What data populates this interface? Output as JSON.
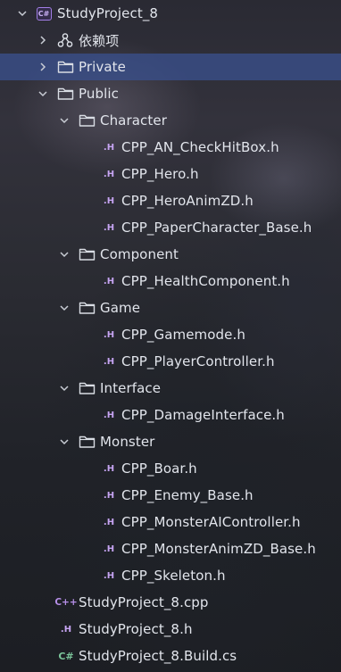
{
  "tree": {
    "root": {
      "label": "StudyProject_8",
      "icon": "project-icon",
      "expanded": true
    },
    "dependencies": {
      "label": "依赖项",
      "icon": "dependencies-icon",
      "expanded": false
    },
    "private_folder": {
      "label": "Private",
      "icon": "folder-icon",
      "expanded": false,
      "selected": true
    },
    "public_folder": {
      "label": "Public",
      "icon": "folder-icon",
      "expanded": true,
      "folders": [
        {
          "label": "Character",
          "files": [
            "CPP_AN_CheckHitBox.h",
            "CPP_Hero.h",
            "CPP_HeroAnimZD.h",
            "CPP_PaperCharacter_Base.h"
          ]
        },
        {
          "label": "Component",
          "files": [
            "CPP_HealthComponent.h"
          ]
        },
        {
          "label": "Game",
          "files": [
            "CPP_Gamemode.h",
            "CPP_PlayerController.h"
          ]
        },
        {
          "label": "Interface",
          "files": [
            "CPP_DamageInterface.h"
          ]
        },
        {
          "label": "Monster",
          "files": [
            "CPP_Boar.h",
            "CPP_Enemy_Base.h",
            "CPP_MonsterAIController.h",
            "CPP_MonsterAnimZD_Base.h",
            "CPP_Skeleton.h"
          ]
        }
      ]
    },
    "root_files": [
      {
        "label": "StudyProject_8.cpp",
        "badge": "C++",
        "icon": "cpp-file-icon"
      },
      {
        "label": "StudyProject_8.h",
        "badge": ".H",
        "icon": "header-file-icon"
      },
      {
        "label": "StudyProject_8.Build.cs",
        "badge": "C#",
        "icon": "csharp-file-icon"
      }
    ]
  },
  "badges": {
    "header": ".H",
    "project": "C#"
  },
  "colors": {
    "selection": "#3a508c",
    "text": "#e2e5ec",
    "folder_outline": "#d9dde4",
    "header_badge": "#c6a4f2",
    "csharp_badge": "#7ac49a",
    "project_badge_border": "#a27ee6"
  }
}
